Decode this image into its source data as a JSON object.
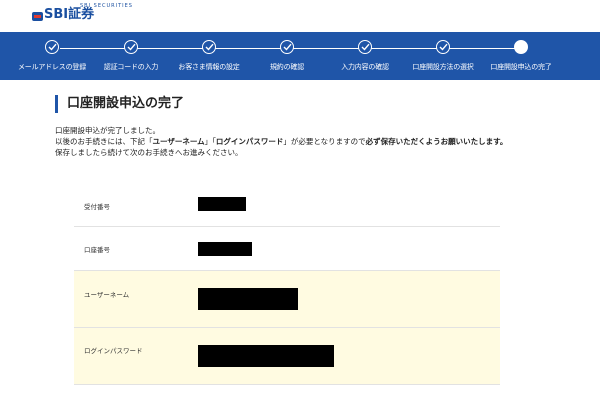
{
  "brand": {
    "sub": "SBI SECURITIES",
    "name": "SBI証券"
  },
  "steps": [
    {
      "label": "メールアドレスの登録",
      "state": "done"
    },
    {
      "label": "認証コードの入力",
      "state": "done"
    },
    {
      "label": "お客さま情報の設定",
      "state": "done"
    },
    {
      "label": "規約の確認",
      "state": "done"
    },
    {
      "label": "入力内容の確認",
      "state": "done"
    },
    {
      "label": "口座開設方法の選択",
      "state": "done"
    },
    {
      "label": "口座開設申込の完了",
      "state": "current"
    }
  ],
  "page": {
    "title": "口座開設申込の完了",
    "msg1": "口座開設申込が完了しました。",
    "msg2_pre": "以後のお手続きには、下記「",
    "msg2_term1": "ユーザーネーム",
    "msg2_mid": "」「",
    "msg2_term2": "ログインパスワード",
    "msg2_post": "」が必要となりますので",
    "msg2_emph": "必ず保存いただくようお願いいたします。",
    "msg3": "保存しましたら続けて次のお手続きへお進みください。"
  },
  "fields": [
    {
      "label": "受付番号",
      "value": ""
    },
    {
      "label": "口座番号",
      "value": ""
    },
    {
      "label": "ユーザーネーム",
      "value": ""
    },
    {
      "label": "ログインパスワード",
      "value": ""
    }
  ]
}
